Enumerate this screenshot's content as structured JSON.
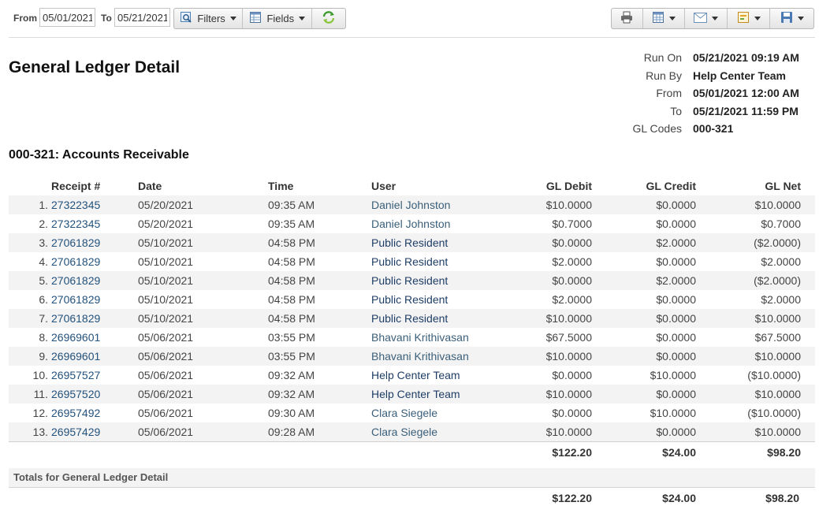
{
  "filters": {
    "from_label": "From",
    "from_value": "05/01/2021",
    "to_label": "To",
    "to_value": "05/21/2021",
    "filters_label": "Filters",
    "fields_label": "Fields"
  },
  "toolbar_icons": [
    "print-icon",
    "grid-icon",
    "email-icon",
    "export-icon",
    "save-icon"
  ],
  "report": {
    "title": "General Ledger Detail",
    "meta": [
      {
        "label": "Run On",
        "value": "05/21/2021 09:19 AM"
      },
      {
        "label": "Run By",
        "value": "Help Center Team"
      },
      {
        "label": "From",
        "value": "05/01/2021 12:00 AM"
      },
      {
        "label": "To",
        "value": "05/21/2021 11:59 PM"
      },
      {
        "label": "GL Codes",
        "value": "000-321"
      }
    ]
  },
  "section": {
    "title": "000-321: Accounts Receivable",
    "columns": [
      "Receipt #",
      "Date",
      "Time",
      "User",
      "GL Debit",
      "GL Credit",
      "GL Net"
    ],
    "rows": [
      {
        "n": "1.",
        "receipt": "27322345",
        "date": "05/20/2021",
        "time": "09:35 AM",
        "user": "Daniel Johnston",
        "debit": "$10.0000",
        "credit": "$0.0000",
        "net": "$10.0000"
      },
      {
        "n": "2.",
        "receipt": "27322345",
        "date": "05/20/2021",
        "time": "09:35 AM",
        "user": "Daniel Johnston",
        "debit": "$0.7000",
        "credit": "$0.0000",
        "net": "$0.7000"
      },
      {
        "n": "3.",
        "receipt": "27061829",
        "date": "05/10/2021",
        "time": "04:58 PM",
        "user": "Public Resident",
        "debit": "$0.0000",
        "credit": "$2.0000",
        "net": "($2.0000)"
      },
      {
        "n": "4.",
        "receipt": "27061829",
        "date": "05/10/2021",
        "time": "04:58 PM",
        "user": "Public Resident",
        "debit": "$2.0000",
        "credit": "$0.0000",
        "net": "$2.0000"
      },
      {
        "n": "5.",
        "receipt": "27061829",
        "date": "05/10/2021",
        "time": "04:58 PM",
        "user": "Public Resident",
        "debit": "$0.0000",
        "credit": "$2.0000",
        "net": "($2.0000)"
      },
      {
        "n": "6.",
        "receipt": "27061829",
        "date": "05/10/2021",
        "time": "04:58 PM",
        "user": "Public Resident",
        "debit": "$2.0000",
        "credit": "$0.0000",
        "net": "$2.0000"
      },
      {
        "n": "7.",
        "receipt": "27061829",
        "date": "05/10/2021",
        "time": "04:58 PM",
        "user": "Public Resident",
        "debit": "$10.0000",
        "credit": "$0.0000",
        "net": "$10.0000"
      },
      {
        "n": "8.",
        "receipt": "26969601",
        "date": "05/06/2021",
        "time": "03:55 PM",
        "user": "Bhavani Krithivasan",
        "debit": "$67.5000",
        "credit": "$0.0000",
        "net": "$67.5000"
      },
      {
        "n": "9.",
        "receipt": "26969601",
        "date": "05/06/2021",
        "time": "03:55 PM",
        "user": "Bhavani Krithivasan",
        "debit": "$10.0000",
        "credit": "$0.0000",
        "net": "$10.0000"
      },
      {
        "n": "10.",
        "receipt": "26957527",
        "date": "05/06/2021",
        "time": "09:32 AM",
        "user": "Help Center Team",
        "debit": "$0.0000",
        "credit": "$10.0000",
        "net": "($10.0000)"
      },
      {
        "n": "11.",
        "receipt": "26957520",
        "date": "05/06/2021",
        "time": "09:32 AM",
        "user": "Help Center Team",
        "debit": "$10.0000",
        "credit": "$0.0000",
        "net": "$10.0000"
      },
      {
        "n": "12.",
        "receipt": "26957492",
        "date": "05/06/2021",
        "time": "09:30 AM",
        "user": "Clara Siegele",
        "debit": "$0.0000",
        "credit": "$10.0000",
        "net": "($10.0000)"
      },
      {
        "n": "13.",
        "receipt": "26957429",
        "date": "05/06/2021",
        "time": "09:28 AM",
        "user": "Clara Siegele",
        "debit": "$10.0000",
        "credit": "$0.0000",
        "net": "$10.0000"
      }
    ],
    "subtotal": {
      "debit": "$122.20",
      "credit": "$24.00",
      "net": "$98.20"
    }
  },
  "totals": {
    "label": "Totals for General Ledger Detail",
    "debit": "$122.20",
    "credit": "$24.00",
    "net": "$98.20"
  }
}
